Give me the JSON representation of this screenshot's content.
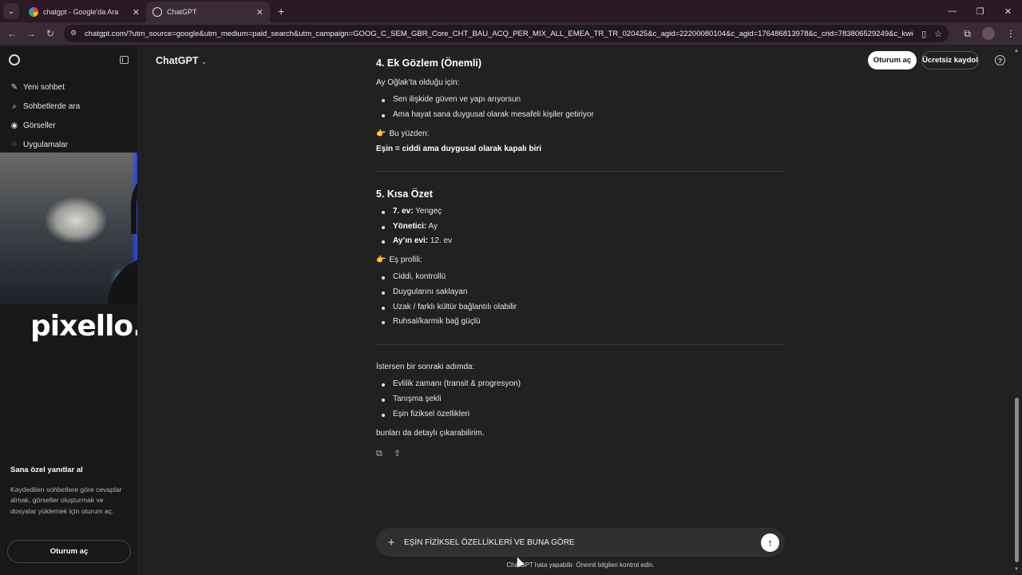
{
  "browser": {
    "tabs": [
      {
        "title": "chatgpt - Google'da Ara",
        "favicon": "google-icon"
      },
      {
        "title": "ChatGPT",
        "favicon": "chatgpt-icon"
      }
    ],
    "url": "chatgpt.com/?utm_source=google&utm_medium=paid_search&utm_campaign=GOOG_C_SEM_GBR_Core_CHT_BAU_ACQ_PER_MIX_ALL_EMEA_TR_TR_020425&c_agid=22200080104&c_agid=176486813978&c_crid=783806529249&c_kwid=kwd-19272..."
  },
  "sidebar": {
    "items": [
      {
        "label": "Yeni sohbet",
        "icon": "new-chat-icon"
      },
      {
        "label": "Sohbetlerde ara",
        "icon": "search-icon"
      },
      {
        "label": "Görseller",
        "icon": "images-icon"
      },
      {
        "label": "Uygulamalar",
        "icon": "apps-icon"
      }
    ],
    "promo_title": "Sana özel yanıtlar al",
    "promo_text": "Kaydedilen sohbetlere göre cevaplar almak, görseller oluşturmak ve dosyalar yüklemek için oturum aç.",
    "login_button": "Oturum aç"
  },
  "overlay": {
    "brand": "pixello."
  },
  "header": {
    "model": "ChatGPT",
    "login": "Oturum aç",
    "signup": "Ücretsiz kaydol"
  },
  "message": {
    "section4_title": "4. Ek Gözlem (Önemli)",
    "section4_intro": "Ay Oğlak’ta olduğu için:",
    "section4_bullets": [
      "Sen ilişkide güven ve yapı arıyorsun",
      "Ama hayat sana duygusal olarak mesafeli kişiler getiriyor"
    ],
    "section4_pointer": "Bu yüzden:",
    "section4_conclusion": "Eşin = ciddi ama duygusal olarak kapalı biri",
    "section5_title": "5. Kısa Özet",
    "section5_bullets": [
      {
        "key": "7. ev:",
        "value": " Yengeç"
      },
      {
        "key": "Yönetici:",
        "value": " Ay"
      },
      {
        "key": "Ay’ın evi:",
        "value": " 12. ev"
      }
    ],
    "section5_pointer": "Eş profili:",
    "profile_bullets": [
      "Ciddi, kontrollü",
      "Duygularını saklayan",
      "Uzak / farklı kültür bağlantılı olabilir",
      "Ruhsal/karmik bağ güçlü"
    ],
    "next_intro": "İstersen bir sonraki adımda:",
    "next_bullets": [
      "Evlilik zamanı (transit & progresyon)",
      "Tanışma şekli",
      "Eşin fiziksel özellikleri"
    ],
    "closing": "bunları da detaylı çıkarabilirim."
  },
  "composer": {
    "text": "EŞİN FİZİKSEL ÖZELLİKLERİ VE BUNA GÖRE"
  },
  "disclaimer": "ChatGPT hata yapabilir. Önemli bilgileri kontrol edin."
}
